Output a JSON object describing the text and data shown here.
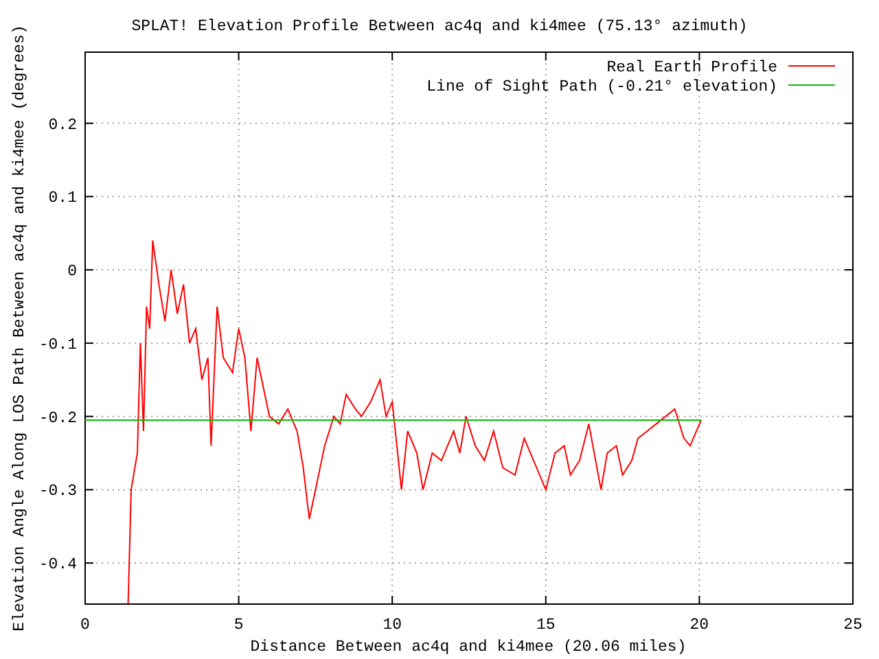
{
  "chart": {
    "chart_data": {
      "type": "line",
      "title": "SPLAT! Elevation Profile Between ac4q and ki4mee (75.13° azimuth)",
      "xlabel": "Distance Between ac4q and ki4mee (20.06 miles)",
      "ylabel": "Elevation Angle Along LOS Path Between ac4q and ki4mee (degrees)",
      "x": [
        0,
        1.4,
        1.5,
        1.7,
        1.8,
        1.9,
        2.0,
        2.1,
        2.2,
        2.4,
        2.6,
        2.8,
        3.0,
        3.2,
        3.4,
        3.6,
        3.8,
        4.0,
        4.1,
        4.3,
        4.5,
        4.8,
        5.0,
        5.2,
        5.4,
        5.6,
        5.8,
        6.0,
        6.3,
        6.6,
        6.9,
        7.1,
        7.3,
        7.5,
        7.8,
        8.1,
        8.3,
        8.5,
        8.8,
        9.0,
        9.3,
        9.6,
        9.8,
        10.0,
        10.3,
        10.5,
        10.8,
        11.0,
        11.3,
        11.6,
        12.0,
        12.2,
        12.4,
        12.7,
        13.0,
        13.3,
        13.6,
        14.0,
        14.3,
        14.6,
        15.0,
        15.3,
        15.6,
        15.8,
        16.1,
        16.4,
        16.8,
        17.0,
        17.3,
        17.5,
        17.8,
        18.0,
        18.3,
        18.6,
        18.9,
        19.2,
        19.5,
        19.7,
        20.06
      ],
      "series": [
        {
          "name": "Real Earth Profile",
          "color": "#ff0000",
          "values": [
            null,
            -0.455,
            -0.3,
            -0.25,
            -0.1,
            -0.22,
            -0.05,
            -0.08,
            0.04,
            -0.02,
            -0.07,
            0.0,
            -0.06,
            -0.02,
            -0.1,
            -0.08,
            -0.15,
            -0.12,
            -0.24,
            -0.05,
            -0.12,
            -0.14,
            -0.08,
            -0.12,
            -0.22,
            -0.12,
            -0.16,
            -0.2,
            -0.21,
            -0.19,
            -0.22,
            -0.27,
            -0.34,
            -0.3,
            -0.24,
            -0.2,
            -0.21,
            -0.17,
            -0.19,
            -0.2,
            -0.18,
            -0.15,
            -0.2,
            -0.18,
            -0.3,
            -0.22,
            -0.25,
            -0.3,
            -0.25,
            -0.26,
            -0.22,
            -0.25,
            -0.2,
            -0.24,
            -0.26,
            -0.22,
            -0.27,
            -0.28,
            -0.23,
            -0.26,
            -0.3,
            -0.25,
            -0.24,
            -0.28,
            -0.26,
            -0.21,
            -0.3,
            -0.25,
            -0.24,
            -0.28,
            -0.26,
            -0.23,
            -0.22,
            -0.21,
            -0.2,
            -0.19,
            -0.23,
            -0.24,
            -0.205
          ]
        },
        {
          "name": "Line of Sight Path (-0.21° elevation)",
          "color": "#00c000",
          "values": [
            -0.205,
            -0.205,
            -0.205,
            -0.205,
            -0.205,
            -0.205,
            -0.205,
            -0.205,
            -0.205,
            -0.205,
            -0.205,
            -0.205,
            -0.205,
            -0.205,
            -0.205,
            -0.205,
            -0.205,
            -0.205,
            -0.205,
            -0.205,
            -0.205,
            -0.205,
            -0.205,
            -0.205,
            -0.205,
            -0.205,
            -0.205,
            -0.205,
            -0.205,
            -0.205,
            -0.205,
            -0.205,
            -0.205,
            -0.205,
            -0.205,
            -0.205,
            -0.205,
            -0.205,
            -0.205,
            -0.205,
            -0.205,
            -0.205,
            -0.205,
            -0.205,
            -0.205,
            -0.205,
            -0.205,
            -0.205,
            -0.205,
            -0.205,
            -0.205,
            -0.205,
            -0.205,
            -0.205,
            -0.205,
            -0.205,
            -0.205,
            -0.205,
            -0.205,
            -0.205,
            -0.205,
            -0.205,
            -0.205,
            -0.205,
            -0.205,
            -0.205,
            -0.205,
            -0.205,
            -0.205,
            -0.205,
            -0.205,
            -0.205,
            -0.205,
            -0.205,
            -0.205,
            -0.205,
            -0.205,
            -0.205,
            -0.205
          ]
        }
      ],
      "grid": true,
      "legend": true,
      "xlim": [
        0,
        25
      ],
      "ylim": [
        -0.456,
        0.297
      ],
      "xticks": [
        0,
        5,
        10,
        15,
        20,
        25
      ],
      "yticks": [
        -0.4,
        -0.3,
        -0.2,
        -0.1,
        0,
        0.1,
        0.2
      ]
    }
  }
}
